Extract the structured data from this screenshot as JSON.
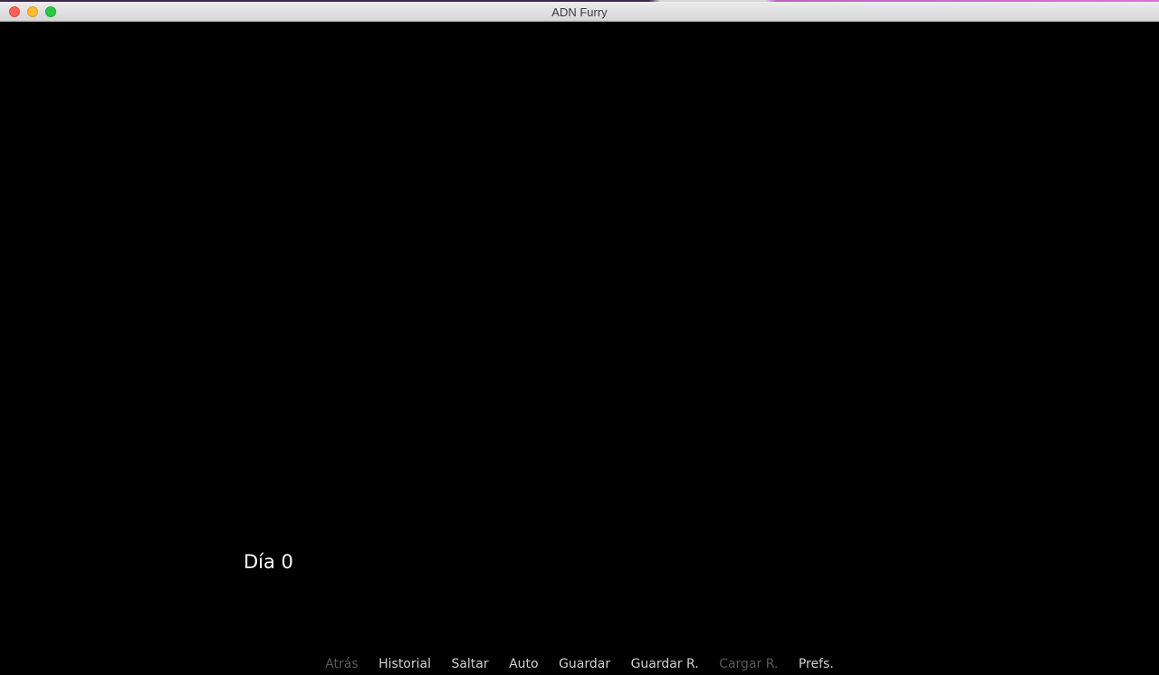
{
  "window": {
    "title": "ADN Furry"
  },
  "game": {
    "day_label": "Día 0"
  },
  "quick_menu": {
    "items": [
      {
        "label": "Atrás",
        "enabled": false
      },
      {
        "label": "Historial",
        "enabled": true
      },
      {
        "label": "Saltar",
        "enabled": true
      },
      {
        "label": "Auto",
        "enabled": true
      },
      {
        "label": "Guardar",
        "enabled": true
      },
      {
        "label": "Guardar R.",
        "enabled": true
      },
      {
        "label": "Cargar R.",
        "enabled": false
      },
      {
        "label": "Prefs.",
        "enabled": true
      }
    ]
  },
  "colors": {
    "background": "#000000",
    "text": "#ffffff",
    "menu_enabled": "#d0d0d0",
    "menu_disabled": "#5a5a5a"
  }
}
